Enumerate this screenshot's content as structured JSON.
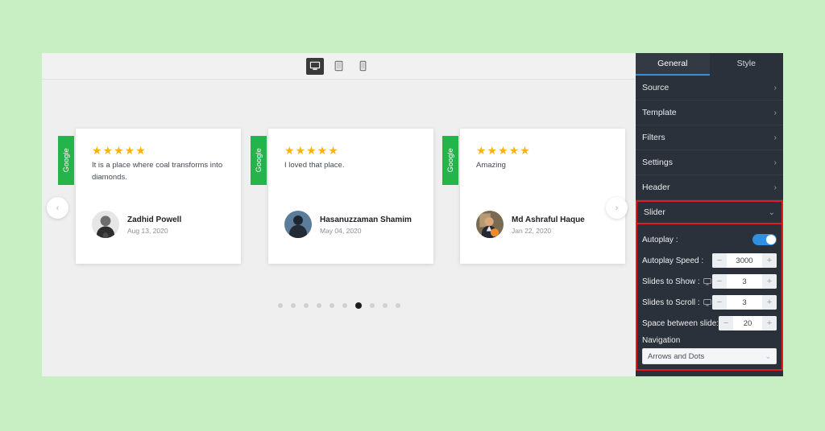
{
  "canvas": {
    "device_toolbar": {
      "devices": [
        {
          "name": "desktop",
          "label": "Desktop",
          "active": true
        },
        {
          "name": "tablet",
          "label": "Tablet",
          "active": false
        },
        {
          "name": "mobile",
          "label": "Mobile",
          "active": false
        }
      ]
    },
    "slider": {
      "prev_arrow": "‹",
      "next_arrow": "›",
      "badge_label": "Google",
      "stars": "★★★★★",
      "dots_count": 10,
      "active_dot_index": 6,
      "cards": [
        {
          "badge": "Google",
          "rating": 5,
          "stars": "★★★★★",
          "text": "It is a place where coal transforms into diamonds.",
          "name": "Zadhid Powell",
          "date": "Aug 13, 2020"
        },
        {
          "badge": "Google",
          "rating": 5,
          "stars": "★★★★★",
          "text": "I loved that place.",
          "name": "Hasanuzzaman Shamim",
          "date": "May 04, 2020"
        },
        {
          "badge": "Google",
          "rating": 5,
          "stars": "★★★★★",
          "text": "Amazing",
          "name": "Md Ashraful Haque",
          "date": "Jan 22, 2020"
        }
      ]
    }
  },
  "panel": {
    "tabs": [
      {
        "label": "General",
        "active": true
      },
      {
        "label": "Style",
        "active": false
      }
    ],
    "accordion": [
      {
        "label": "Source",
        "icon": "chevron-right-icon",
        "chevron": "›",
        "open": false,
        "highlighted": false
      },
      {
        "label": "Template",
        "icon": "chevron-right-icon",
        "chevron": "›",
        "open": false,
        "highlighted": false
      },
      {
        "label": "Filters",
        "icon": "chevron-right-icon",
        "chevron": "›",
        "open": false,
        "highlighted": false
      },
      {
        "label": "Settings",
        "icon": "chevron-right-icon",
        "chevron": "›",
        "open": false,
        "highlighted": false
      },
      {
        "label": "Header",
        "icon": "chevron-right-icon",
        "chevron": "›",
        "open": false,
        "highlighted": false
      },
      {
        "label": "Slider",
        "icon": "chevron-down-icon",
        "chevron": "⌄",
        "open": true,
        "highlighted": true
      }
    ],
    "slider_settings": {
      "autoplay": {
        "label": "Autoplay :",
        "enabled": true
      },
      "autoplay_speed": {
        "label": "Autoplay Speed :",
        "value": "3000",
        "minus": "−",
        "plus": "+"
      },
      "slides_to_show": {
        "label": "Slides to Show :",
        "value": "3",
        "minus": "−",
        "plus": "+",
        "responsive_icon": "monitor-icon"
      },
      "slides_to_scroll": {
        "label": "Slides to Scroll :",
        "value": "3",
        "minus": "−",
        "plus": "+",
        "responsive_icon": "monitor-icon"
      },
      "space_between": {
        "label": "Space between slide:",
        "value": "20",
        "minus": "−",
        "plus": "+"
      },
      "navigation": {
        "label": "Navigation",
        "selected": "Arrows and Dots",
        "chevron": "⌄"
      }
    }
  },
  "colors": {
    "page_background": "#c8eec4",
    "canvas_background": "#efefef",
    "panel_background": "#2b313a",
    "accent_blue": "#2f8fe0",
    "highlight_red": "#e01b24",
    "google_green": "#25b34b",
    "star_gold": "#fbb304"
  }
}
